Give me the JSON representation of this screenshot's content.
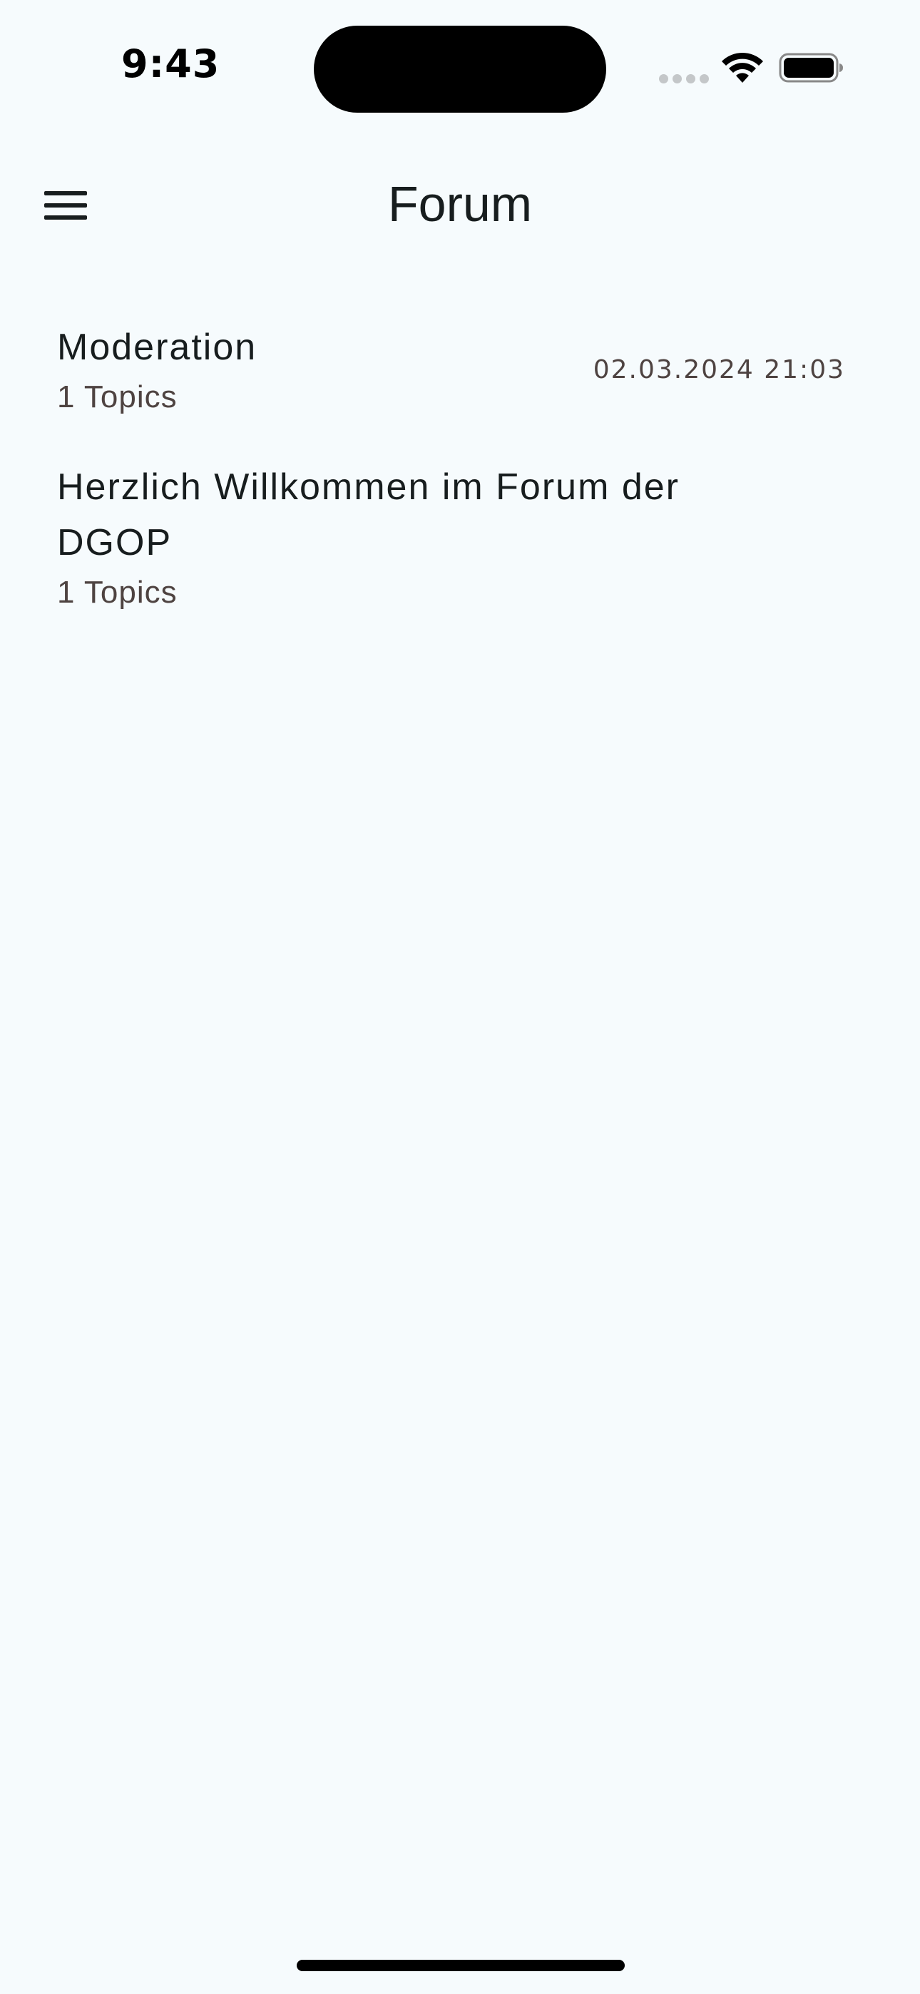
{
  "status_bar": {
    "time": "9:43",
    "icons": {
      "signal": "signal-dots-icon",
      "wifi": "wifi-icon",
      "battery": "battery-icon"
    }
  },
  "app_bar": {
    "title": "Forum",
    "menu_icon": "hamburger-menu-icon"
  },
  "forum": {
    "items": [
      {
        "title": "Moderation",
        "topics": "1 Topics",
        "last_post": "02.03.2024 21:03"
      },
      {
        "title": "Herzlich Willkommen im Forum der DGOP",
        "topics": "1 Topics",
        "last_post": ""
      }
    ]
  },
  "colors": {
    "background": "#f6fbfd",
    "text_primary": "#171d1e",
    "text_secondary": "#4e4341"
  }
}
